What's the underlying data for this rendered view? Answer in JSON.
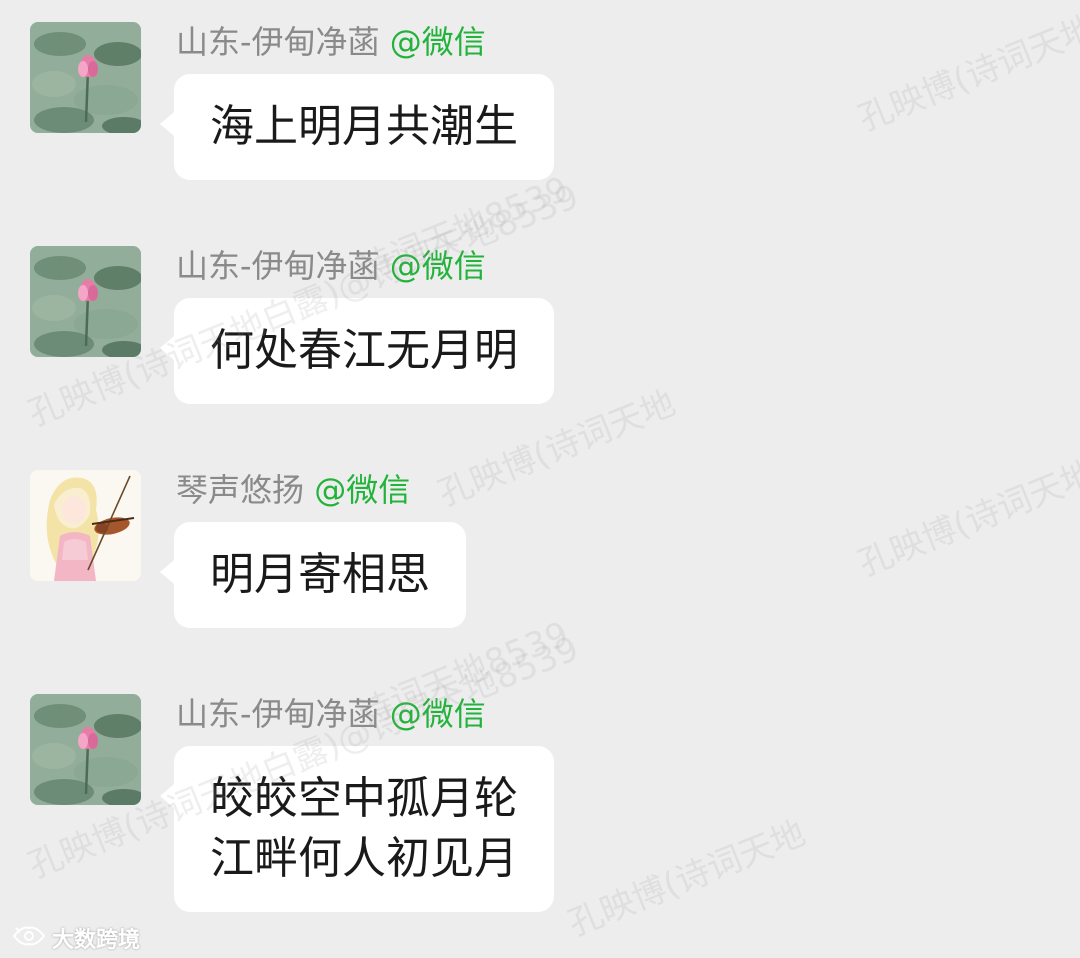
{
  "watermark": {
    "credit": "孔映博(诗词天地白露)@诗词天地8539",
    "account": "孔映博(诗词天地",
    "handle": "诗词天地8539"
  },
  "messages": [
    {
      "sender": "山东-伊甸净菡",
      "source": "@微信",
      "avatar_icon": "lotus-pond-avatar-icon",
      "lines": [
        "海上明月共潮生"
      ]
    },
    {
      "sender": "山东-伊甸净菡",
      "source": "@微信",
      "avatar_icon": "lotus-pond-avatar-icon",
      "lines": [
        "何处春江无月明"
      ]
    },
    {
      "sender": "琴声悠扬",
      "source": "@微信",
      "avatar_icon": "violinist-girl-avatar-icon",
      "lines": [
        "明月寄相思"
      ]
    },
    {
      "sender": "山东-伊甸净菡",
      "source": "@微信",
      "avatar_icon": "lotus-pond-avatar-icon",
      "lines": [
        "皎皎空中孤月轮",
        "江畔何人初见月"
      ]
    }
  ],
  "brand": {
    "logo_icon": "weibo-eye-logo-icon",
    "text": "大数跨境"
  },
  "colors": {
    "background": "#ededee",
    "bubble": "#ffffff",
    "sender_name": "#8a8a8a",
    "source_tag": "#22b33a"
  }
}
